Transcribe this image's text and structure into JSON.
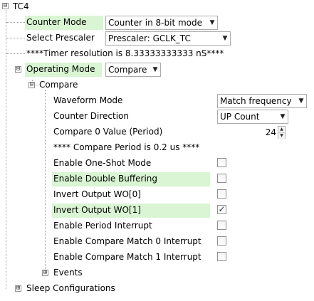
{
  "tree": {
    "root": {
      "label": "TC4",
      "expander": "⊟"
    },
    "counter_mode": {
      "label": "Counter Mode",
      "value": "Counter in 8-bit mode"
    },
    "prescaler": {
      "label": "Select Prescaler",
      "value": "Prescaler: GCLK_TC"
    },
    "timer_resolution": "****Timer resolution is 8.33333333333 nS****",
    "operating_mode": {
      "label": "Operating Mode",
      "value": "Compare",
      "expander": "⊟"
    },
    "compare": {
      "label": "Compare",
      "expander": "⊟",
      "waveform_mode": {
        "label": "Waveform Mode",
        "value": "Match frequency"
      },
      "counter_direction": {
        "label": "Counter Direction",
        "value": "UP Count"
      },
      "compare0": {
        "label": "Compare 0 Value (Period)",
        "value": "24"
      },
      "period_note": "**** Compare Period is 0.2 us ****",
      "checks": [
        {
          "label": "Enable One-Shot Mode",
          "checked": false
        },
        {
          "label": "Enable Double Buffering",
          "checked": false
        },
        {
          "label": "Invert Output WO[0]",
          "checked": false
        },
        {
          "label": "Invert Output WO[1]",
          "checked": true
        },
        {
          "label": "Enable Period Interrupt",
          "checked": false
        },
        {
          "label": "Enable Compare Match 0 Interrupt",
          "checked": false
        },
        {
          "label": "Enable Compare Match 1 Interrupt",
          "checked": false
        }
      ],
      "events": {
        "label": "Events",
        "expander": "⊞"
      }
    },
    "sleep": {
      "label": "Sleep Configurations",
      "expander": "⊞"
    }
  },
  "glyphs": {
    "dropdown_arrow": "▼",
    "check_mark": "✓",
    "spin_up": "▲",
    "spin_down": "▼"
  },
  "colors": {
    "highlight": "#d9f5d3"
  }
}
